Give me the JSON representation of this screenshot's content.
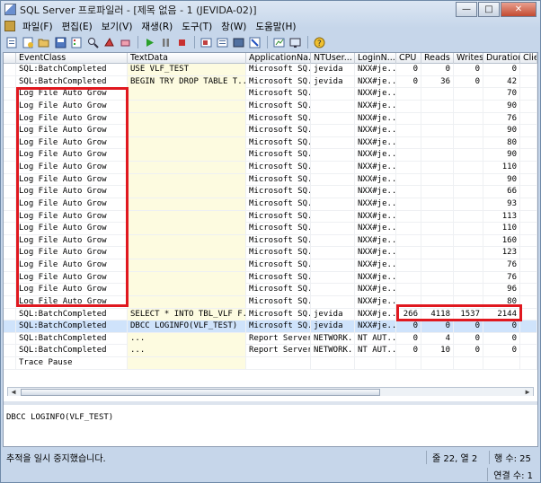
{
  "window": {
    "title": "SQL Server 프로파일러 - [제목 없음 - 1 (JEVIDA-02)]"
  },
  "menu": [
    "파일(F)",
    "편집(E)",
    "보기(V)",
    "재생(R)",
    "도구(T)",
    "창(W)",
    "도움말(H)"
  ],
  "toolbar_icons": [
    "new-trace-icon",
    "new-template-icon",
    "open-icon",
    "save-icon",
    "properties-icon",
    "find-icon",
    "clear-icon",
    "erase-icon",
    "run-icon",
    "pause-icon",
    "stop-icon",
    "replay-icon",
    "step-icon",
    "run-to-cursor-icon",
    "toggle-breakpoint-icon",
    "auto-scroll-icon",
    "monitor-icon",
    "help-icon"
  ],
  "columns": [
    "EventClass",
    "TextData",
    "ApplicationNa...",
    "NTUser...",
    "LoginN...",
    "CPU",
    "Reads",
    "Writes",
    "Duration",
    "Clie"
  ],
  "rows": [
    {
      "event": "SQL:BatchCompleted",
      "text": "USE VLF_TEST",
      "app": "Microsoft SQ...",
      "user": "jevida",
      "login": "NXX#je...",
      "cpu": "0",
      "reads": "0",
      "writes": "0",
      "duration": "0"
    },
    {
      "event": "SQL:BatchCompleted",
      "text": "  BEGIN TRY   DROP TABLE T...",
      "app": "Microsoft SQ...",
      "user": "jevida",
      "login": "NXX#je...",
      "cpu": "0",
      "reads": "36",
      "writes": "0",
      "duration": "42"
    },
    {
      "event": "Log File Auto Grow",
      "text": "",
      "app": "Microsoft SQ...",
      "user": "",
      "login": "NXX#je...",
      "cpu": "",
      "reads": "",
      "writes": "",
      "duration": "70"
    },
    {
      "event": "Log File Auto Grow",
      "text": "",
      "app": "Microsoft SQ...",
      "user": "",
      "login": "NXX#je...",
      "cpu": "",
      "reads": "",
      "writes": "",
      "duration": "90"
    },
    {
      "event": "Log File Auto Grow",
      "text": "",
      "app": "Microsoft SQ...",
      "user": "",
      "login": "NXX#je...",
      "cpu": "",
      "reads": "",
      "writes": "",
      "duration": "76"
    },
    {
      "event": "Log File Auto Grow",
      "text": "",
      "app": "Microsoft SQ...",
      "user": "",
      "login": "NXX#je...",
      "cpu": "",
      "reads": "",
      "writes": "",
      "duration": "90"
    },
    {
      "event": "Log File Auto Grow",
      "text": "",
      "app": "Microsoft SQ...",
      "user": "",
      "login": "NXX#je...",
      "cpu": "",
      "reads": "",
      "writes": "",
      "duration": "80"
    },
    {
      "event": "Log File Auto Grow",
      "text": "",
      "app": "Microsoft SQ...",
      "user": "",
      "login": "NXX#je...",
      "cpu": "",
      "reads": "",
      "writes": "",
      "duration": "90"
    },
    {
      "event": "Log File Auto Grow",
      "text": "",
      "app": "Microsoft SQ...",
      "user": "",
      "login": "NXX#je...",
      "cpu": "",
      "reads": "",
      "writes": "",
      "duration": "110"
    },
    {
      "event": "Log File Auto Grow",
      "text": "",
      "app": "Microsoft SQ...",
      "user": "",
      "login": "NXX#je...",
      "cpu": "",
      "reads": "",
      "writes": "",
      "duration": "90"
    },
    {
      "event": "Log File Auto Grow",
      "text": "",
      "app": "Microsoft SQ...",
      "user": "",
      "login": "NXX#je...",
      "cpu": "",
      "reads": "",
      "writes": "",
      "duration": "66"
    },
    {
      "event": "Log File Auto Grow",
      "text": "",
      "app": "Microsoft SQ...",
      "user": "",
      "login": "NXX#je...",
      "cpu": "",
      "reads": "",
      "writes": "",
      "duration": "93"
    },
    {
      "event": "Log File Auto Grow",
      "text": "",
      "app": "Microsoft SQ...",
      "user": "",
      "login": "NXX#je...",
      "cpu": "",
      "reads": "",
      "writes": "",
      "duration": "113"
    },
    {
      "event": "Log File Auto Grow",
      "text": "",
      "app": "Microsoft SQ...",
      "user": "",
      "login": "NXX#je...",
      "cpu": "",
      "reads": "",
      "writes": "",
      "duration": "110"
    },
    {
      "event": "Log File Auto Grow",
      "text": "",
      "app": "Microsoft SQ...",
      "user": "",
      "login": "NXX#je...",
      "cpu": "",
      "reads": "",
      "writes": "",
      "duration": "160"
    },
    {
      "event": "Log File Auto Grow",
      "text": "",
      "app": "Microsoft SQ...",
      "user": "",
      "login": "NXX#je...",
      "cpu": "",
      "reads": "",
      "writes": "",
      "duration": "123"
    },
    {
      "event": "Log File Auto Grow",
      "text": "",
      "app": "Microsoft SQ...",
      "user": "",
      "login": "NXX#je...",
      "cpu": "",
      "reads": "",
      "writes": "",
      "duration": "76"
    },
    {
      "event": "Log File Auto Grow",
      "text": "",
      "app": "Microsoft SQ...",
      "user": "",
      "login": "NXX#je...",
      "cpu": "",
      "reads": "",
      "writes": "",
      "duration": "76"
    },
    {
      "event": "Log File Auto Grow",
      "text": "",
      "app": "Microsoft SQ...",
      "user": "",
      "login": "NXX#je...",
      "cpu": "",
      "reads": "",
      "writes": "",
      "duration": "96"
    },
    {
      "event": "Log File Auto Grow",
      "text": "",
      "app": "Microsoft SQ...",
      "user": "",
      "login": "NXX#je...",
      "cpu": "",
      "reads": "",
      "writes": "",
      "duration": "80"
    },
    {
      "event": "SQL:BatchCompleted",
      "text": "  SELECT * INTO TBL_VLF  F...",
      "app": "Microsoft SQ...",
      "user": "jevida",
      "login": "NXX#je...",
      "cpu": "266",
      "reads": "4118",
      "writes": "1537",
      "duration": "2144"
    },
    {
      "event": "SQL:BatchCompleted",
      "text": "  DBCC LOGINFO(VLF_TEST)",
      "app": "Microsoft SQ...",
      "user": "jevida",
      "login": "NXX#je...",
      "cpu": "0",
      "reads": "0",
      "writes": "0",
      "duration": "0",
      "selected": true
    },
    {
      "event": "SQL:BatchCompleted",
      "text": "...",
      "app": "Report Server",
      "user": "NETWORK...",
      "login": "NT AUT...",
      "cpu": "0",
      "reads": "4",
      "writes": "0",
      "duration": "0"
    },
    {
      "event": "SQL:BatchCompleted",
      "text": "...",
      "app": "Report Server",
      "user": "NETWORK...",
      "login": "NT AUT...",
      "cpu": "0",
      "reads": "10",
      "writes": "0",
      "duration": "0"
    },
    {
      "event": "Trace Pause",
      "text": "",
      "app": "",
      "user": "",
      "login": "",
      "cpu": "",
      "reads": "",
      "writes": "",
      "duration": ""
    }
  ],
  "detail_text": "DBCC LOGINFO(VLF_TEST)",
  "status": {
    "message": "추적을 일시 중지했습니다.",
    "position": "줄 22, 열 2",
    "rows": "행 수: 25",
    "connections": "연결 수: 1"
  },
  "colors": {
    "highlight": "#e0181f",
    "selected_row": "#cfe3fb",
    "text_column": "#fdfbe0"
  }
}
